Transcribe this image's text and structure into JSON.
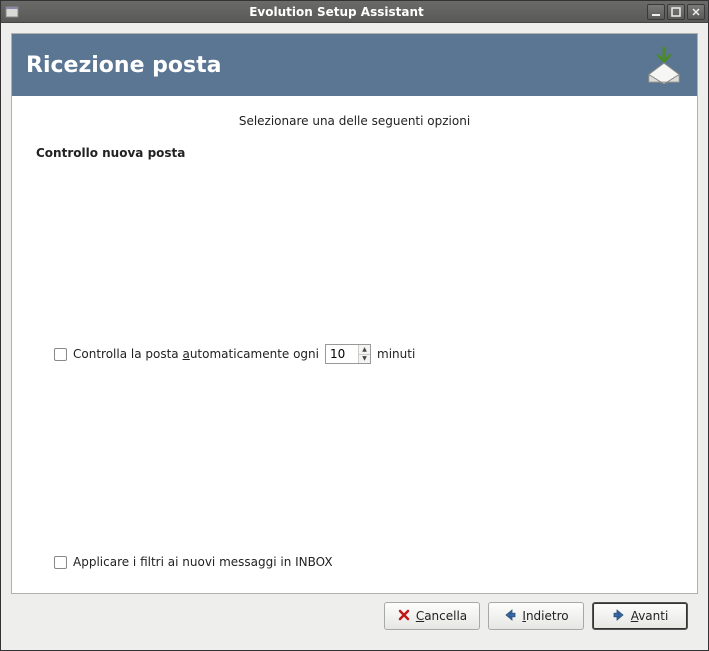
{
  "window": {
    "title": "Evolution Setup Assistant"
  },
  "banner": {
    "title": "Ricezione posta"
  },
  "instruction": "Selezionare una delle seguenti opzioni",
  "section": {
    "title": "Controllo nuova posta"
  },
  "checkAuto": {
    "prefix": "Controlla la posta ",
    "access": "a",
    "rest": "utomaticamente ogni",
    "value": "10",
    "suffix": "minuti"
  },
  "checkFilters": {
    "label": "Applicare i filtri ai nuovi messaggi in INBOX"
  },
  "buttons": {
    "cancel_access": "C",
    "cancel_rest": "ancella",
    "back_access": "I",
    "back_rest": "ndietro",
    "forward_access": "A",
    "forward_rest": "vanti"
  }
}
